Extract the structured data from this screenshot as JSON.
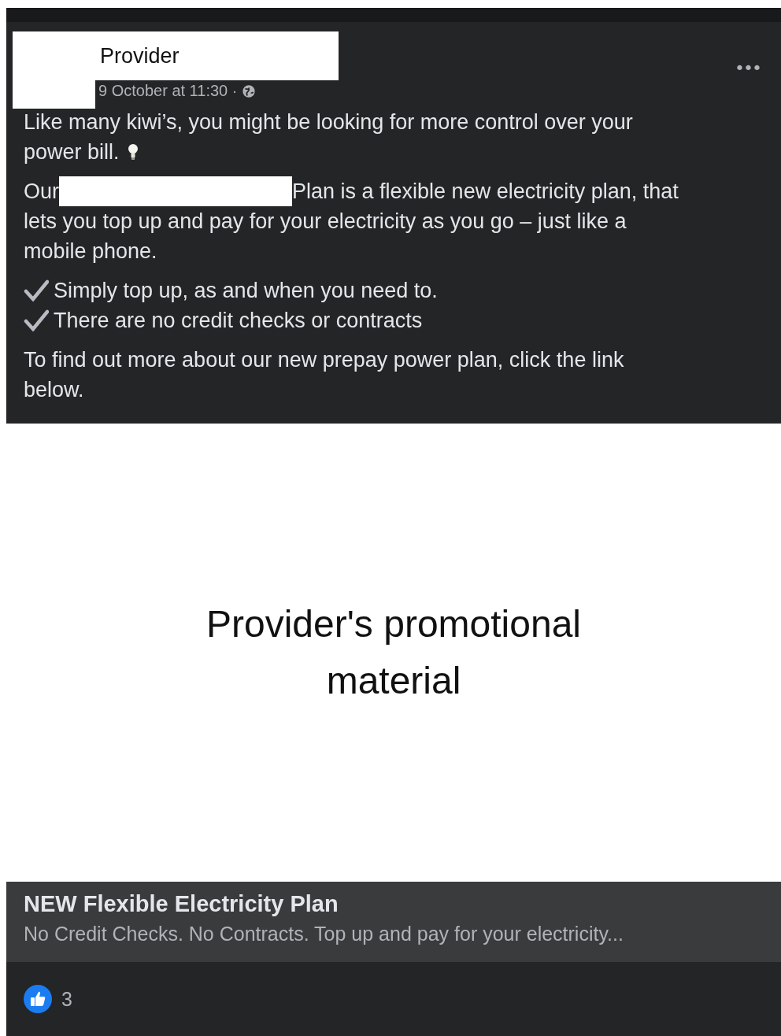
{
  "post": {
    "author": "Provider",
    "timestamp": "9 October at 11:30 ·",
    "more_menu": "•••",
    "paragraphs": [
      {
        "kind": "text_icon",
        "lines": [
          "Like many kiwi’s, you might be looking for more control over your",
          "power bill."
        ]
      },
      {
        "kind": "redacted",
        "before": "Our",
        "after": "Plan is a flexible new electricity plan, that",
        "continuation": "lets you top up and pay for your electricity as you go – just like a mobile phone."
      },
      {
        "kind": "checklist",
        "items": [
          "Simply top up, as and when you need to.",
          "There are no credit checks or contracts"
        ]
      },
      {
        "kind": "text",
        "text": "To find out more about our new prepay power plan, click the link below."
      }
    ]
  },
  "link_preview": {
    "image_text": "Provider's promotional material",
    "title": "NEW Flexible Electricity Plan",
    "description": "No Credit Checks. No Contracts. Top up and pay for your electricity..."
  },
  "reactions": {
    "count": "3"
  }
}
